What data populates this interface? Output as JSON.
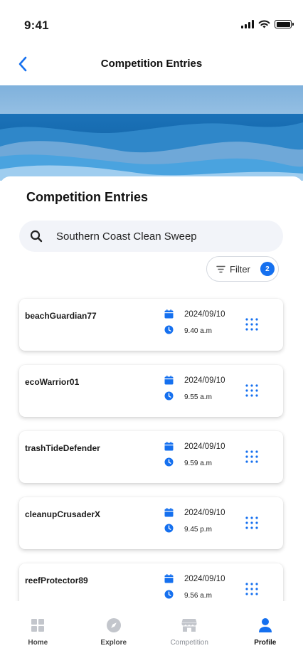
{
  "status_bar": {
    "time": "9:41"
  },
  "nav": {
    "title": "Competition Entries",
    "back_icon": "chevron-left-icon"
  },
  "colors": {
    "accent": "#1570ef",
    "search_bg": "#f2f4f9"
  },
  "section": {
    "title": "Competition Entries"
  },
  "search": {
    "value": "Southern Coast Clean Sweep",
    "icon": "search-icon"
  },
  "filter": {
    "label": "Filter",
    "count": "2",
    "icon": "filter-icon"
  },
  "entries": [
    {
      "name": "beachGuardian77",
      "date": "2024/09/10",
      "time": "9.40 a.m"
    },
    {
      "name": "ecoWarrior01",
      "date": "2024/09/10",
      "time": "9.55 a.m"
    },
    {
      "name": "trashTideDefender",
      "date": "2024/09/10",
      "time": "9.59 a.m"
    },
    {
      "name": "cleanupCrusaderX",
      "date": "2024/09/10",
      "time": "9.45 p.m"
    },
    {
      "name": "reefProtector89",
      "date": "2024/09/10",
      "time": "9.56 a.m"
    }
  ],
  "tabs": [
    {
      "label": "Home",
      "icon": "home-grid-icon"
    },
    {
      "label": "Explore",
      "icon": "compass-icon"
    },
    {
      "label": "Competition",
      "icon": "store-icon"
    },
    {
      "label": "Profile",
      "icon": "user-icon",
      "active": true
    }
  ]
}
